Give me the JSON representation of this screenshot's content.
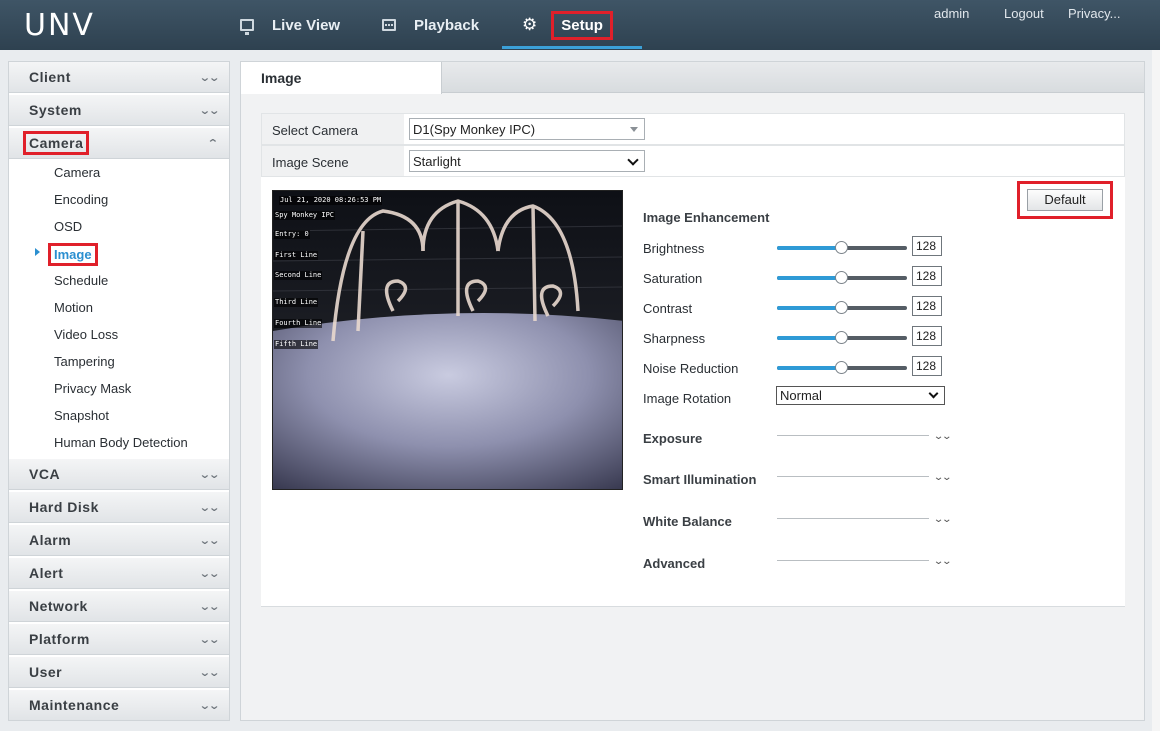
{
  "header": {
    "logo": "UNV",
    "nav": [
      {
        "label": "Live View",
        "icon": "monitor-icon"
      },
      {
        "label": "Playback",
        "icon": "film-icon"
      },
      {
        "label": "Setup",
        "icon": "gear-icon"
      }
    ],
    "user": "admin",
    "logout": "Logout",
    "privacy": "Privacy..."
  },
  "sidebar": {
    "groups": [
      {
        "label": "Client"
      },
      {
        "label": "System"
      },
      {
        "label": "Camera"
      },
      {
        "label": "VCA"
      },
      {
        "label": "Hard Disk"
      },
      {
        "label": "Alarm"
      },
      {
        "label": "Alert"
      },
      {
        "label": "Network"
      },
      {
        "label": "Platform"
      },
      {
        "label": "User"
      },
      {
        "label": "Maintenance"
      }
    ],
    "camera_items": [
      "Camera",
      "Encoding",
      "OSD",
      "Image",
      "Schedule",
      "Motion",
      "Video Loss",
      "Tampering",
      "Privacy Mask",
      "Snapshot",
      "Human Body Detection"
    ],
    "active_item": "Image"
  },
  "main": {
    "tab": "Image",
    "select_camera_label": "Select Camera",
    "select_camera_value": "D1(Spy Monkey IPC)",
    "image_scene_label": "Image Scene",
    "image_scene_value": "Starlight",
    "default_button": "Default",
    "osd": {
      "timestamp": "Jul 21, 2020 08:26:53 PM",
      "name": "Spy Monkey IPC",
      "entry": "Entry:  0",
      "first": "First Line",
      "second": "Second Line",
      "third": "Third Line",
      "fourth": "Fourth Line",
      "fifth": "Fifth Line"
    },
    "enhancement_title": "Image Enhancement",
    "sliders": [
      {
        "label": "Brightness",
        "value": "128",
        "fraction": 0.5
      },
      {
        "label": "Saturation",
        "value": "128",
        "fraction": 0.5
      },
      {
        "label": "Contrast",
        "value": "128",
        "fraction": 0.5
      },
      {
        "label": "Sharpness",
        "value": "128",
        "fraction": 0.5
      },
      {
        "label": "Noise Reduction",
        "value": "128",
        "fraction": 0.5
      }
    ],
    "rotation_label": "Image Rotation",
    "rotation_value": "Normal",
    "sections": [
      "Exposure",
      "Smart Illumination",
      "White Balance",
      "Advanced"
    ]
  },
  "colors": {
    "header_bg": "#34495a",
    "accent": "#2b8fd0",
    "highlight": "#e0202a"
  }
}
